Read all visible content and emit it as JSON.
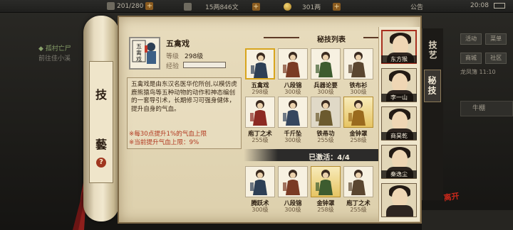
{
  "topbar": {
    "energy": "201/280",
    "silver": "15两846文",
    "gold": "301两",
    "notice": "公告",
    "time": "20:08"
  },
  "background": {
    "quest_title": "◆ 孤村亡尸",
    "quest_sub": "前往佳小溪",
    "menu": [
      "活动",
      "菜单",
      "商城",
      "社区"
    ],
    "row3": "龙凤簿  11:10",
    "panel": "牛棚"
  },
  "roller": {
    "title_top": "技",
    "title_bottom": "藝",
    "help": "?"
  },
  "detail": {
    "name": "五禽戏",
    "icon_text": "五禽戏",
    "level_label": "等级",
    "level_value": "298级",
    "exp_label": "经验",
    "description": "五禽戏是由东汉名医华佗所创,以模仿虎鹿熊猿鸟等五种动物的动作和神态编创的一套导引术，长期修习可强身健体，提升自身的气血。",
    "effect_1": "※每30点提升1%的气血上限",
    "effect_2": "※当前提升气血上限：9%"
  },
  "skill_list": {
    "title": "秘技列表",
    "items": [
      {
        "name": "五禽戏",
        "level": "298级",
        "style": "sel"
      },
      {
        "name": "八段锦",
        "level": "300级",
        "style": ""
      },
      {
        "name": "兵器论要",
        "level": "300级",
        "style": ""
      },
      {
        "name": "铁布衫",
        "level": "300级",
        "style": ""
      },
      {
        "name": "庖丁之术",
        "level": "255级",
        "style": ""
      },
      {
        "name": "千斤坠",
        "level": "300级",
        "style": ""
      },
      {
        "name": "铁帚功",
        "level": "255级",
        "style": "gray"
      },
      {
        "name": "金钟罩",
        "level": "258级",
        "style": "gold"
      }
    ],
    "active_text": "已激活：4/4",
    "active_items": [
      {
        "name": "腾跃术",
        "level": "300级",
        "style": ""
      },
      {
        "name": "八段锦",
        "level": "300级",
        "style": ""
      },
      {
        "name": "金钟罩",
        "level": "258级",
        "style": "gold"
      },
      {
        "name": "庖丁之术",
        "level": "255级",
        "style": ""
      }
    ]
  },
  "characters": [
    {
      "name": "东方猴",
      "active": true
    },
    {
      "name": "李一山",
      "active": false
    },
    {
      "name": "商昊乾",
      "active": false
    },
    {
      "name": "秦逸尘",
      "active": false
    },
    {
      "name": "",
      "active": false
    }
  ],
  "tabs": [
    "技艺",
    "秘技"
  ],
  "close_label": "离开",
  "colors": {
    "parchment": "#e3d6b4",
    "accent_red": "#a8301f",
    "effect_red": "#b23a22",
    "gold_card": "#e6c463"
  }
}
